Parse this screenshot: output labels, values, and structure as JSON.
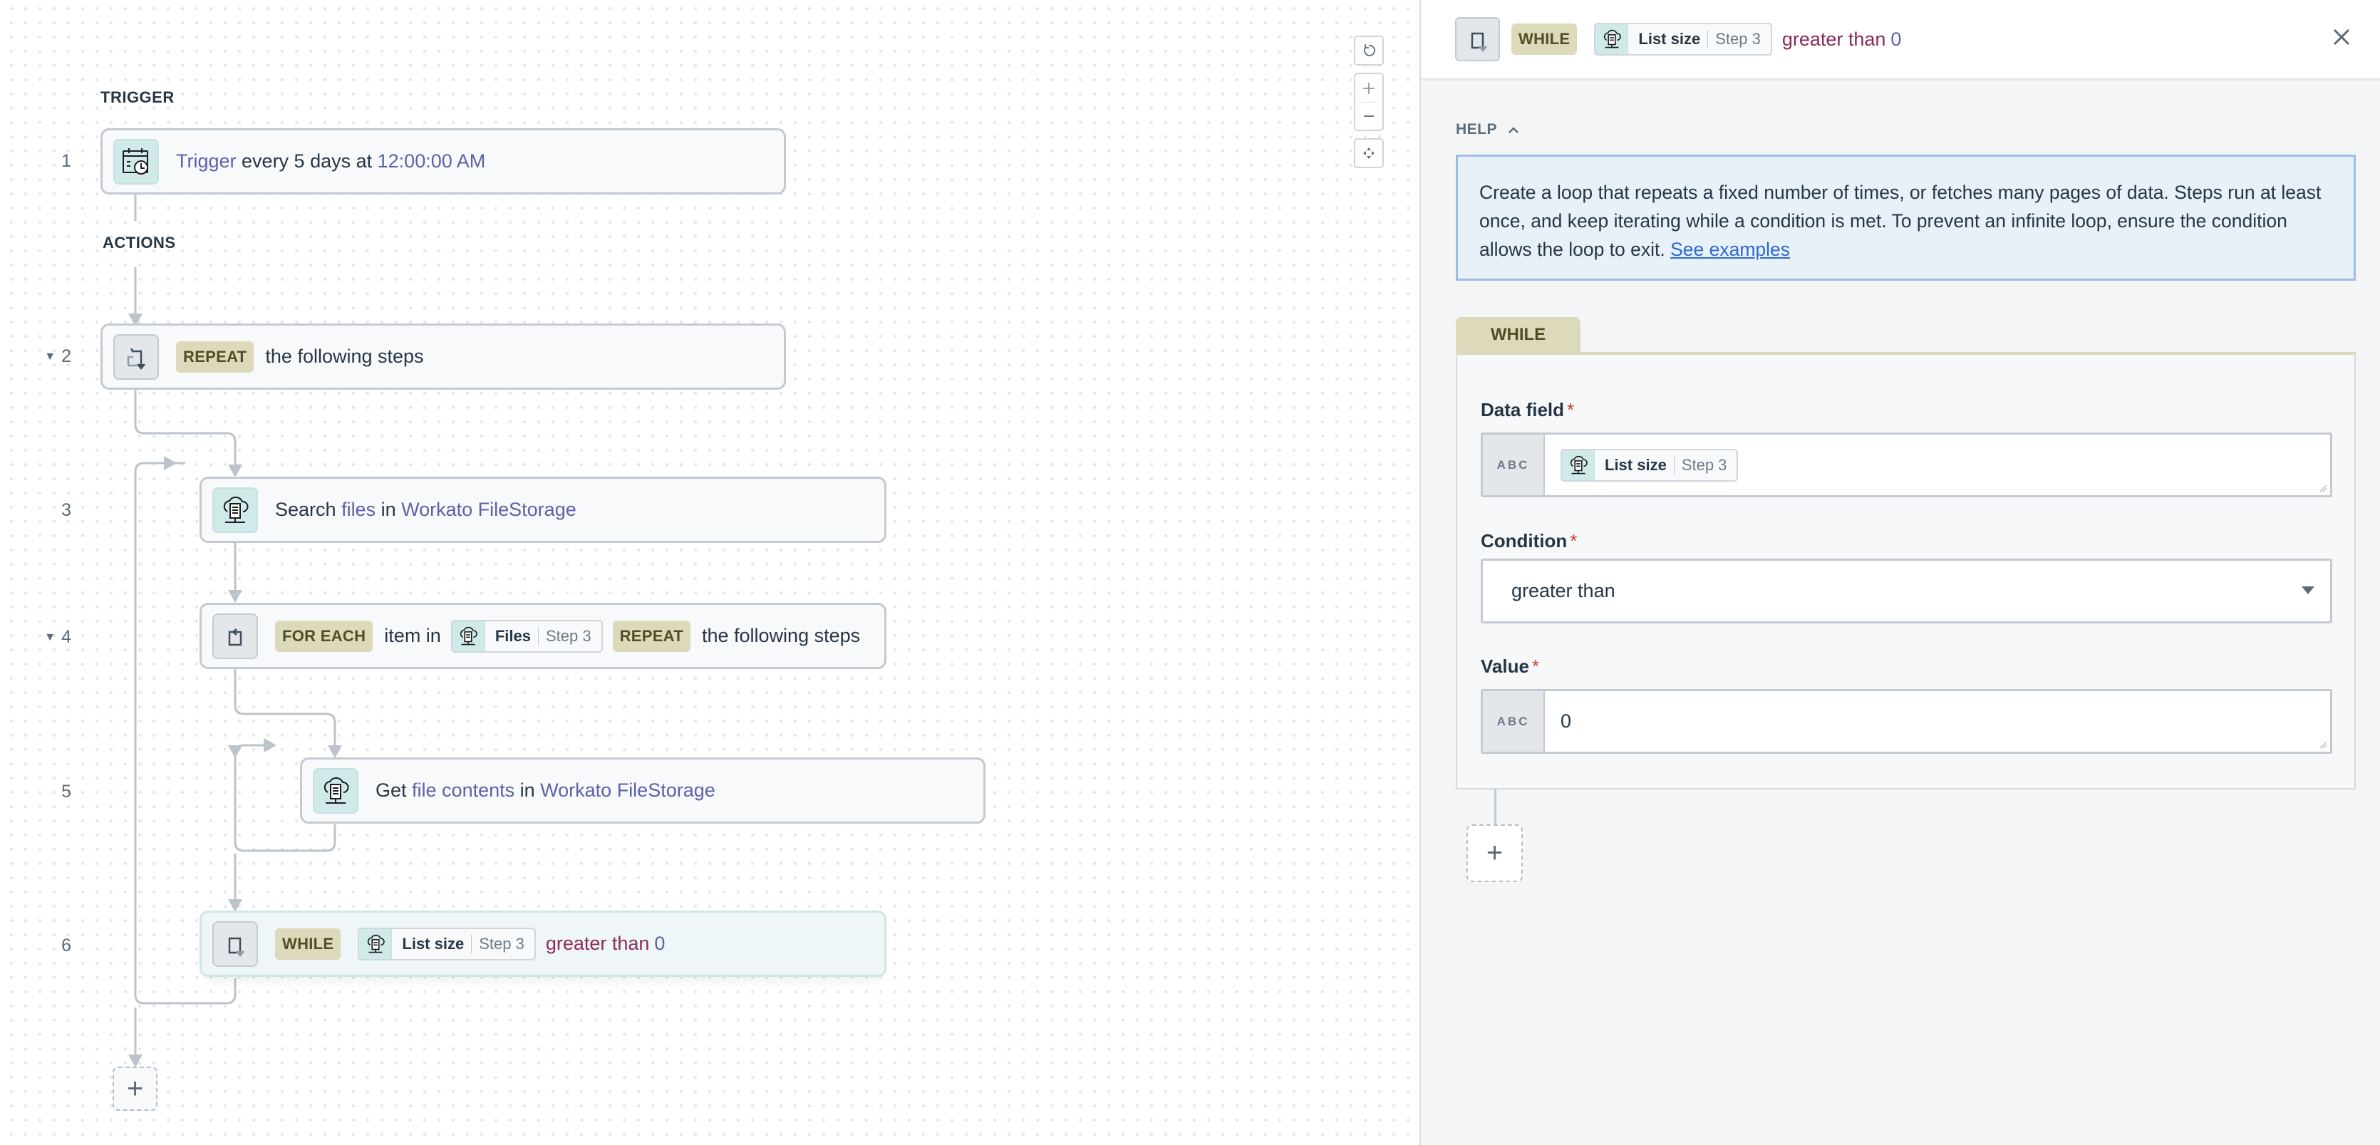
{
  "canvas": {
    "trigger_label": "TRIGGER",
    "actions_label": "ACTIONS",
    "steps": [
      {
        "number": "1",
        "collapsible": false,
        "icon": "calendar-clock-icon",
        "parts": [
          {
            "t": "Trigger",
            "s": "hl"
          },
          {
            "t": " every 5 days at ",
            "s": ""
          },
          {
            "t": "12:00:00 AM",
            "s": "hl"
          }
        ]
      },
      {
        "number": "2",
        "collapsible": true,
        "icon": "repeat-loop-icon",
        "keyword": "REPEAT",
        "text": "the following steps"
      },
      {
        "number": "3",
        "collapsible": false,
        "icon": "file-storage-icon",
        "parts": [
          {
            "t": "Search ",
            "s": ""
          },
          {
            "t": "files",
            "s": "hl"
          },
          {
            "t": " in ",
            "s": ""
          },
          {
            "t": "Workato FileStorage",
            "s": "hl"
          }
        ]
      },
      {
        "number": "4",
        "collapsible": true,
        "icon": "foreach-loop-icon",
        "keyword": "FOR EACH",
        "text_before_pill": "item in",
        "pill": {
          "field": "Files",
          "step": "Step 3"
        },
        "keyword2": "REPEAT",
        "text": "the following steps"
      },
      {
        "number": "5",
        "collapsible": false,
        "icon": "file-storage-icon",
        "parts": [
          {
            "t": "Get ",
            "s": ""
          },
          {
            "t": "file contents",
            "s": "hl"
          },
          {
            "t": " in ",
            "s": ""
          },
          {
            "t": "Workato FileStorage",
            "s": "hl"
          }
        ]
      },
      {
        "number": "6",
        "collapsible": false,
        "active": true,
        "icon": "while-loop-icon",
        "keyword": "WHILE",
        "pill": {
          "field": "List size",
          "step": "Step 3"
        },
        "condition": "greater than",
        "value": "0"
      }
    ],
    "add_step_label": "+",
    "zoom_controls": [
      "reset-view",
      "zoom-in",
      "zoom-out",
      "fit-to-screen"
    ]
  },
  "panel": {
    "header": {
      "keyword": "WHILE",
      "pill": {
        "field": "List size",
        "step": "Step 3"
      },
      "condition": "greater than",
      "value": "0"
    },
    "help": {
      "label": "HELP",
      "text": "Create a loop that repeats a fixed number of times, or fetches many pages of data. Steps run at least once, and keep iterating while a condition is met. To prevent an infinite loop, ensure the condition allows the loop to exit. ",
      "link": "See examples"
    },
    "form": {
      "tab": "WHILE",
      "data_field": {
        "label": "Data field",
        "required": "*",
        "type": "ABC",
        "pill": {
          "field": "List size",
          "step": "Step 3"
        }
      },
      "condition": {
        "label": "Condition",
        "required": "*",
        "selected": "greater than"
      },
      "value": {
        "label": "Value",
        "required": "*",
        "type": "ABC",
        "value": "0"
      }
    },
    "add_step_label": "+"
  },
  "colors": {
    "keyword_bg": "#dcdabb",
    "keyword_text": "#4e4f25",
    "highlight": "#5c62a7",
    "condition": "#8b2a5a",
    "link": "#2d6ad0",
    "app_icon_bg": "#cfeae9"
  }
}
